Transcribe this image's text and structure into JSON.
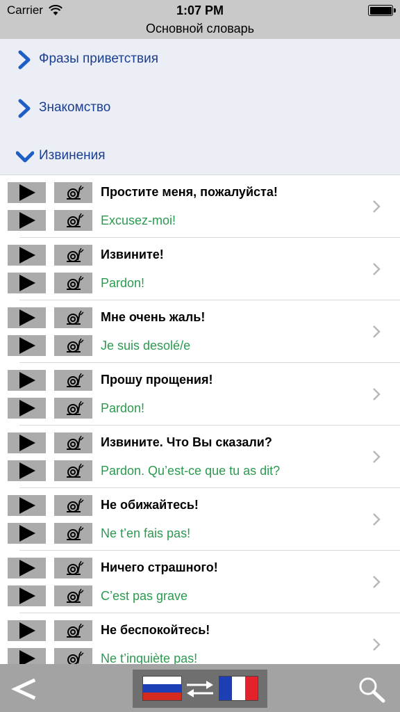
{
  "status": {
    "carrier": "Carrier",
    "time": "1:07 PM"
  },
  "nav": {
    "title": "Основной словарь"
  },
  "sections": [
    {
      "label": "Фразы приветствия",
      "state": "collapsed"
    },
    {
      "label": "Знакомство",
      "state": "collapsed"
    },
    {
      "label": "Извинения",
      "state": "expanded"
    }
  ],
  "phrases": [
    {
      "ru": "Простите меня, пожалуйста!",
      "fr": "Excusez-moi!"
    },
    {
      "ru": "Извините!",
      "fr": "Pardon!"
    },
    {
      "ru": "Мне очень жаль!",
      "fr": "Je suis desolé/e"
    },
    {
      "ru": "Прошу прощения!",
      "fr": "Pardon!"
    },
    {
      "ru": "Извините. Что Вы сказали?",
      "fr": "Pardon. Qu’est-ce que tu as dit?"
    },
    {
      "ru": "Не обижайтесь!",
      "fr": "Ne t’en fais pas!"
    },
    {
      "ru": "Ничего страшного!",
      "fr": "C’est pas grave"
    },
    {
      "ru": "Не беспокойтесь!",
      "fr": "Ne t’inquiète pas!"
    }
  ],
  "icons": {
    "play": "play-icon",
    "slow": "snail-icon",
    "disclosure": "chevron-right-icon",
    "back": "back-arrow-icon",
    "swap": "swap-arrows-icon",
    "search": "search-icon"
  },
  "colors": {
    "section_text": "#1b3f8f",
    "french_text": "#2b9a4f",
    "toolbar": "#a3a3a3"
  }
}
